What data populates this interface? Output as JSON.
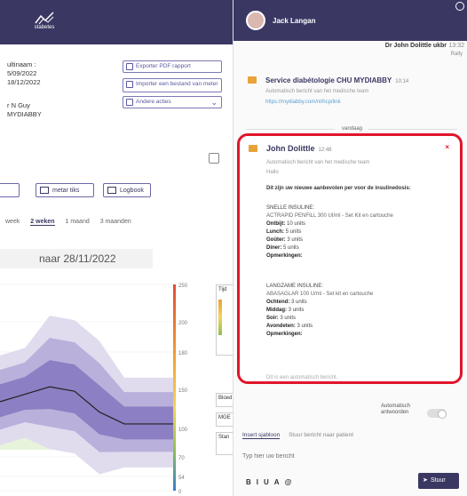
{
  "brand": {
    "name": "stabetes"
  },
  "patient": {
    "line1": "ultinaam :",
    "line2": "5/09/2022",
    "line3": "18/12/2022",
    "line4": "r N Guy",
    "line5": "MYDIABBY"
  },
  "actions": [
    {
      "label": "Exporter PDF rapport"
    },
    {
      "label": "Importer een bestand van meter"
    },
    {
      "label": "Andere acties"
    }
  ],
  "buttons": [
    {
      "label": ""
    },
    {
      "label": "metar tiks"
    },
    {
      "label": "Logbook"
    }
  ],
  "periods": [
    {
      "label": "week"
    },
    {
      "label": "2 weken"
    },
    {
      "label": "1 maand"
    },
    {
      "label": "3 maanden"
    }
  ],
  "date_range": "naar  28/11/2022",
  "chart_data": {
    "type": "area",
    "title": "",
    "xlabel": "",
    "ylabel": "",
    "y_ticks": [
      "250",
      "200",
      "180",
      "150",
      "100",
      "70",
      "54",
      "0"
    ],
    "series": [
      {
        "values": [
          0.55,
          0.5,
          0.45,
          0.48,
          0.62,
          0.7,
          0.7,
          0.7
        ]
      }
    ],
    "colors": {
      "band_outer": "#e0dcee",
      "band_mid": "#b9b1db",
      "band_inner": "#8d7fc3",
      "median": "#222222",
      "target": "#cfe7b8"
    }
  },
  "mini_cards": [
    {
      "label": "Tijd"
    },
    {
      "label": "Bloed"
    },
    {
      "label": "MGE"
    },
    {
      "label": "Stan"
    }
  ],
  "chat": {
    "contact_name": "Jack Langan",
    "prev_sender": "Dr John Dolittle ukbr",
    "prev_time": "13:32",
    "prev_status": "Rally",
    "service_title": "Service diabétologie CHU MYDIABBY",
    "service_time": "10:14",
    "service_auto": "Automatisch bericht van het medische team",
    "service_link": "https://mydiabby.com/nl/hcp/link",
    "separator": "vandaag",
    "card": {
      "author": "John Dolittle",
      "time": "12:48",
      "auto": "Automatisch bericht van het medische team",
      "greeting": "Hallo",
      "intro": "Dit zijn uw nieuwe aanbevolen per voor de insulinedosis:",
      "fast_title": "SNELLE INSULINE:",
      "fast_drug": "ACTRAPID PENFILL 300 UI/ml - Set Kit en cartouche",
      "fast_rows": [
        {
          "k": "Ontbijt:",
          "v": "10 units"
        },
        {
          "k": "Lunch:",
          "v": "5 units"
        },
        {
          "k": "Goûter:",
          "v": "3 units"
        },
        {
          "k": "Diner:",
          "v": "5 units"
        },
        {
          "k": "Opmerkingen:",
          "v": ""
        }
      ],
      "slow_title": "LANGZAME INSULINE:",
      "slow_drug": "ABASAGLAR 100 U/ml - Set kit en cartouche",
      "slow_rows": [
        {
          "k": "Ochtend:",
          "v": "3 units"
        },
        {
          "k": "Middag:",
          "v": "3 units"
        },
        {
          "k": "Soir:",
          "v": "3 units"
        },
        {
          "k": "Avondeten:",
          "v": "3 units"
        },
        {
          "k": "Opmerkingen:",
          "v": ""
        }
      ],
      "footer": "Dit is een automatisch bericht."
    },
    "toggle_label": "Automatisch antwoorden",
    "tabs": [
      {
        "label": "Insert sjabloon"
      },
      {
        "label": "Stuur bericht naar patient"
      }
    ],
    "input_placeholder": "Typ hier uw bericht",
    "formatting": [
      "B",
      "I",
      "U",
      "A",
      "@"
    ],
    "send_label": "Stuur"
  }
}
